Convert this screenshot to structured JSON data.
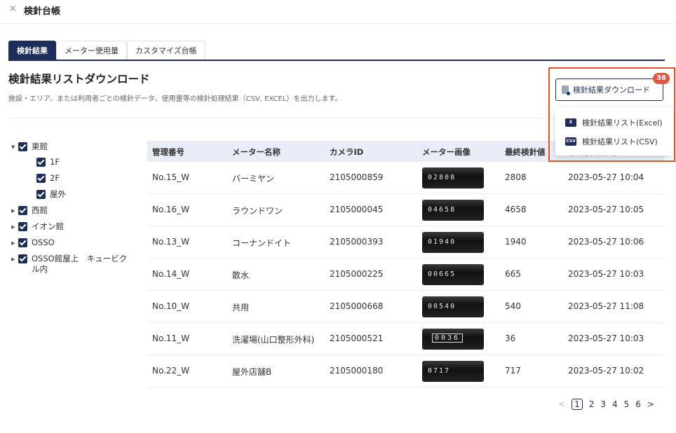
{
  "header": {
    "close_icon": "×",
    "title": "検針台帳"
  },
  "tabs": [
    {
      "label": "検針結果",
      "active": true
    },
    {
      "label": "メーター使用量",
      "active": false
    },
    {
      "label": "カスタマイズ台帳",
      "active": false
    }
  ],
  "section": {
    "title": "検針結果リストダウンロード",
    "description": "施設・エリア、または利用者ごとの検針データ、使用量等の検針処理結果（CSV, EXCEL）を出力します。"
  },
  "tree": {
    "items": [
      {
        "label": "東館",
        "caret": "▼"
      },
      {
        "label": "1F"
      },
      {
        "label": "2F"
      },
      {
        "label": "屋外"
      },
      {
        "label": "西館",
        "caret": "▶"
      },
      {
        "label": "イオン館",
        "caret": "▶"
      },
      {
        "label": "OSSO",
        "caret": "▶"
      },
      {
        "label_line1": "OSSO館屋上　キュービク",
        "label_line2": "ル内",
        "caret": "▶"
      }
    ]
  },
  "table": {
    "headers": [
      "管理番号",
      "メーター名称",
      "カメラID",
      "メーター画像",
      "最終検針値",
      "最終検針日時"
    ],
    "rows": [
      {
        "id": "No.15_W",
        "name": "バーミヤン",
        "camera": "2105000859",
        "image_text": "02808",
        "value": "2808",
        "datetime": "2023-05-27 10:04"
      },
      {
        "id": "No.16_W",
        "name": "ラウンドワン",
        "camera": "2105000045",
        "image_text": "04658",
        "value": "4658",
        "datetime": "2023-05-27 10:05"
      },
      {
        "id": "No.13_W",
        "name": "コーナンドイト",
        "camera": "2105000393",
        "image_text": "01940",
        "value": "1940",
        "datetime": "2023-05-27 10:06"
      },
      {
        "id": "No.14_W",
        "name": "散水",
        "camera": "2105000225",
        "image_text": "00665",
        "value": "665",
        "datetime": "2023-05-27 10:03"
      },
      {
        "id": "No.10_W",
        "name": "共用",
        "camera": "2105000668",
        "image_text": "00540",
        "value": "540",
        "datetime": "2023-05-27 11:08"
      },
      {
        "id": "No.11_W",
        "name": "洗濯場(山口整形外科)",
        "camera": "2105000521",
        "image_text": "0036",
        "value": "36",
        "datetime": "2023-05-27 10:03"
      },
      {
        "id": "No.22_W",
        "name": "屋外店舗B",
        "camera": "2105000180",
        "image_text": "0717",
        "value": "717",
        "datetime": "2023-05-27 10:02"
      }
    ]
  },
  "pagination": {
    "prev": "<",
    "pages": [
      "1",
      "2",
      "3",
      "4",
      "5",
      "6"
    ],
    "current": "1",
    "next": ">"
  },
  "download": {
    "button_label": "検針結果ダウンロード",
    "badge": "38",
    "menu": [
      {
        "label": "検針結果リスト(Excel)",
        "icon": "excel-file-icon",
        "icon_text": "X"
      },
      {
        "label": "検針結果リスト(CSV)",
        "icon": "csv-file-icon",
        "icon_text": "CSV"
      }
    ]
  },
  "colors": {
    "primary": "#1f2d5a",
    "header_bg": "#e9edf8",
    "highlight": "#e2512a",
    "badge": "#e05640"
  }
}
